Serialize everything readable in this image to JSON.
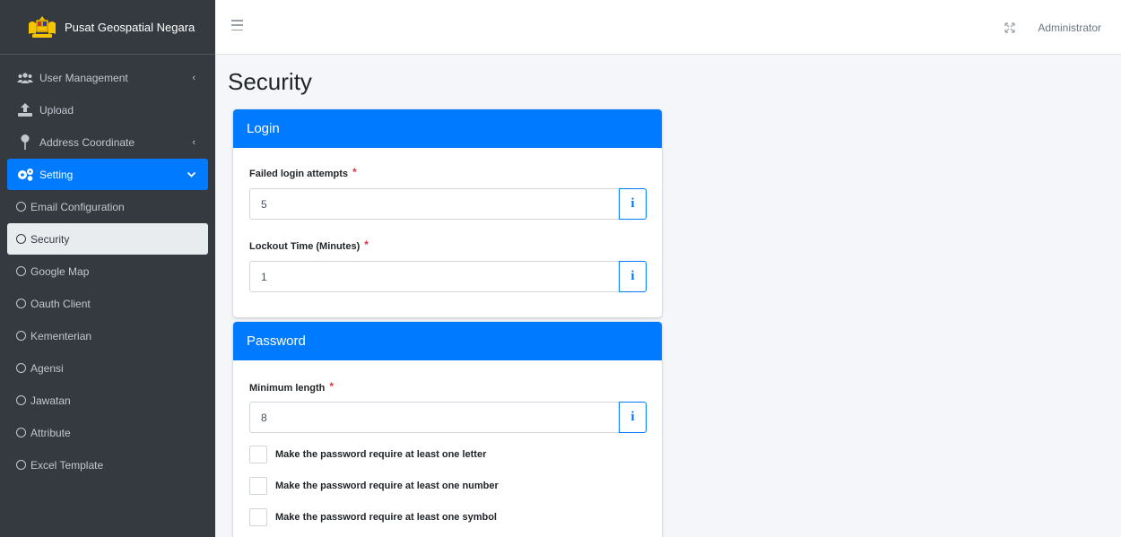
{
  "brand": {
    "title": "Pusat Geospatial Negara",
    "logo_icon": "coat-of-arms-icon"
  },
  "sidebar": {
    "items": [
      {
        "label": "User Management",
        "icon": "users-icon",
        "chevron": "‹"
      },
      {
        "label": "Upload",
        "icon": "upload-icon"
      },
      {
        "label": "Address Coordinate",
        "icon": "map-pin-icon",
        "chevron": "‹"
      },
      {
        "label": "Setting",
        "icon": "gears-icon",
        "chevron": "⌄"
      }
    ],
    "sub_items": [
      {
        "label": "Email Configuration"
      },
      {
        "label": "Security"
      },
      {
        "label": "Google Map"
      },
      {
        "label": "Oauth Client"
      },
      {
        "label": "Kementerian"
      },
      {
        "label": "Agensi"
      },
      {
        "label": "Jawatan"
      },
      {
        "label": "Attribute"
      },
      {
        "label": "Excel Template"
      }
    ]
  },
  "header": {
    "user": "Administrator"
  },
  "page": {
    "title": "Security"
  },
  "login": {
    "header": "Login",
    "failed_label": "Failed login attempts",
    "failed_value": "5",
    "lockout_label": "Lockout Time (Minutes)",
    "lockout_value": "1"
  },
  "password": {
    "header": "Password",
    "min_label": "Minimum length",
    "min_value": "8",
    "checks": [
      "Make the password require at least one letter",
      "Make the password require at least one number",
      "Make the password require at least one symbol"
    ]
  },
  "common": {
    "required_mark": "*",
    "info_glyph": "i"
  },
  "colors": {
    "primary": "#007bff",
    "sidebar": "#343a40",
    "required": "#dc3545"
  }
}
